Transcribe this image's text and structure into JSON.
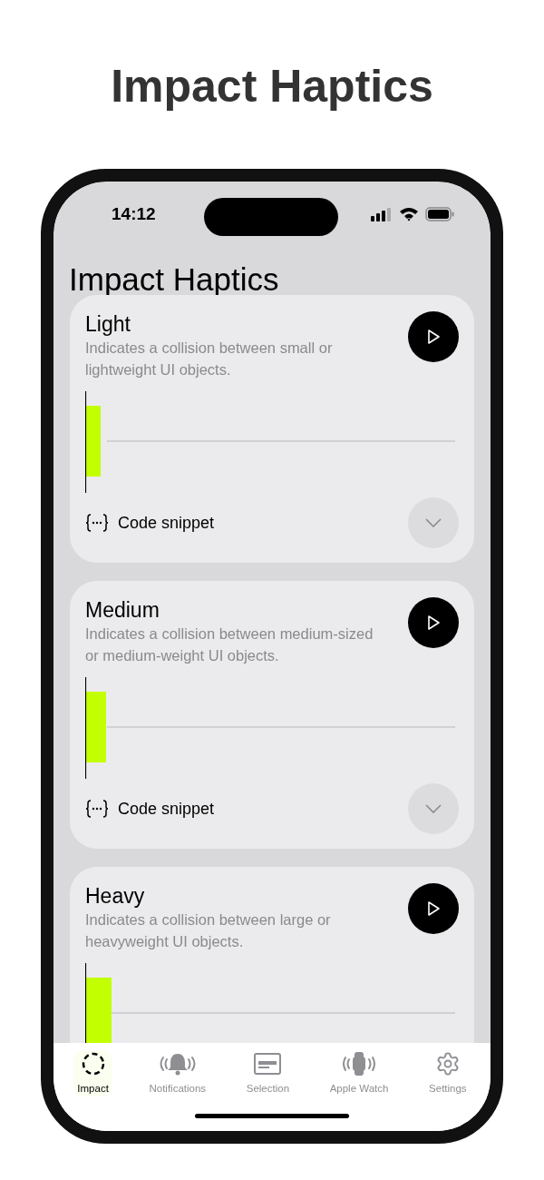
{
  "page_title": "Impact Haptics",
  "status_bar": {
    "time": "14:12"
  },
  "screen_title": "Impact Haptics",
  "cards": [
    {
      "title": "Light",
      "description": "Indicates a collision between small or lightweight UI objects.",
      "snippet_label": "Code snippet"
    },
    {
      "title": "Medium",
      "description": "Indicates a collision between medium-sized or medium-weight UI objects.",
      "snippet_label": "Code snippet"
    },
    {
      "title": "Heavy",
      "description": "Indicates a collision between large or heavyweight UI objects."
    }
  ],
  "tab_bar": [
    {
      "kind": "impact",
      "label": "Impact",
      "selected": true
    },
    {
      "kind": "notifications",
      "label": "Notifications",
      "selected": false
    },
    {
      "kind": "selection",
      "label": "Selection",
      "selected": false
    },
    {
      "kind": "watch",
      "label": "Apple Watch",
      "selected": false
    },
    {
      "kind": "settings",
      "label": "Settings",
      "selected": false
    }
  ]
}
